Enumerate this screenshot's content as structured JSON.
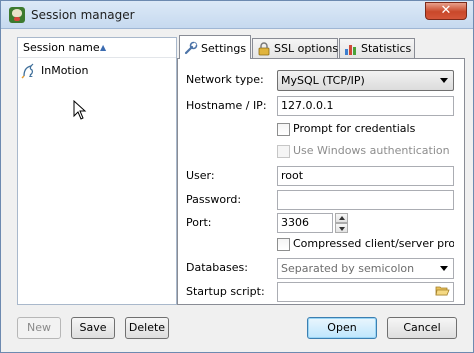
{
  "window": {
    "title": "Session manager",
    "close_glyph": "✕"
  },
  "session_list": {
    "column_header": "Session name",
    "sort_direction": "ascending",
    "items": [
      {
        "label": "InMotion",
        "icon": "mysql-dolphin-icon"
      }
    ]
  },
  "left_buttons": {
    "new": "New",
    "save": "Save",
    "delete": "Delete"
  },
  "tabs": [
    {
      "label": "Settings",
      "icon": "wrench-icon",
      "active": true
    },
    {
      "label": "SSL options",
      "icon": "lock-icon",
      "active": false
    },
    {
      "label": "Statistics",
      "icon": "bar-chart-icon",
      "active": false
    }
  ],
  "settings": {
    "network_type": {
      "label": "Network type:",
      "value": "MySQL (TCP/IP)"
    },
    "hostname": {
      "label": "Hostname / IP:",
      "value": "127.0.0.1"
    },
    "prompt_credentials": {
      "label": "Prompt for credentials",
      "checked": false
    },
    "windows_auth": {
      "label": "Use Windows authentication",
      "checked": false,
      "disabled": true
    },
    "user": {
      "label": "User:",
      "value": "root"
    },
    "password": {
      "label": "Password:",
      "value": ""
    },
    "port": {
      "label": "Port:",
      "value": "3306"
    },
    "compressed": {
      "label": "Compressed client/server protoco",
      "checked": false
    },
    "databases": {
      "label": "Databases:",
      "placeholder": "Separated by semicolon"
    },
    "startup_script": {
      "label": "Startup script:",
      "value": ""
    }
  },
  "bottom_buttons": {
    "open": "Open",
    "cancel": "Cancel"
  },
  "colors": {
    "titlebar": "#c6d9ef",
    "close_button": "#c9482a",
    "primary_button": "#bee6fd"
  }
}
